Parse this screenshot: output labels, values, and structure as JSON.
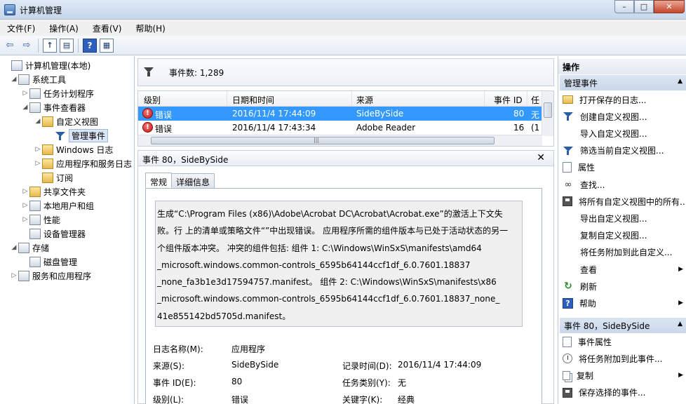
{
  "window": {
    "title": "计算机管理",
    "min": "–",
    "max": "□",
    "close": "✕"
  },
  "menu": [
    "文件(F)",
    "操作(A)",
    "查看(V)",
    "帮助(H)"
  ],
  "toolbar": {
    "back": "⇦",
    "forward": "⇨",
    "help": "?"
  },
  "tree": [
    {
      "label": "计算机管理(本地)",
      "level": 0,
      "arrow": "",
      "icon": "computer-icon"
    },
    {
      "label": "系统工具",
      "level": 1,
      "arrow": "◢",
      "icon": "tools-icon"
    },
    {
      "label": "任务计划程序",
      "level": 2,
      "arrow": "▷",
      "icon": "clock-icon"
    },
    {
      "label": "事件查看器",
      "level": 2,
      "arrow": "◢",
      "icon": "event-viewer-icon"
    },
    {
      "label": "自定义视图",
      "level": 3,
      "arrow": "◢",
      "icon": "folder-icon"
    },
    {
      "label": "管理事件",
      "level": 4,
      "arrow": "",
      "icon": "filter-icon",
      "selected": true
    },
    {
      "label": "Windows 日志",
      "level": 3,
      "arrow": "▷",
      "icon": "folder-icon"
    },
    {
      "label": "应用程序和服务日志",
      "level": 3,
      "arrow": "▷",
      "icon": "folder-icon"
    },
    {
      "label": "订阅",
      "level": 3,
      "arrow": "",
      "icon": "folder-icon"
    },
    {
      "label": "共享文件夹",
      "level": 2,
      "arrow": "▷",
      "icon": "shared-folder-icon"
    },
    {
      "label": "本地用户和组",
      "level": 2,
      "arrow": "▷",
      "icon": "users-icon"
    },
    {
      "label": "性能",
      "level": 2,
      "arrow": "▷",
      "icon": "performance-icon"
    },
    {
      "label": "设备管理器",
      "level": 2,
      "arrow": "",
      "icon": "device-manager-icon"
    },
    {
      "label": "存储",
      "level": 1,
      "arrow": "◢",
      "icon": "storage-icon"
    },
    {
      "label": "磁盘管理",
      "level": 2,
      "arrow": "",
      "icon": "disk-icon"
    },
    {
      "label": "服务和应用程序",
      "level": 1,
      "arrow": "▷",
      "icon": "services-icon"
    }
  ],
  "summary": {
    "count": "事件数: 1,289"
  },
  "grid": {
    "columns": [
      "级别",
      "日期和时间",
      "来源",
      "事件 ID",
      "任"
    ],
    "rows": [
      {
        "level": "错误",
        "datetime": "2016/11/4 17:44:09",
        "source": "SideBySide",
        "id": "80",
        "task": "无",
        "selected": true
      },
      {
        "level": "错误",
        "datetime": "2016/11/4 17:43:34",
        "source": "Adobe Reader",
        "id": "16",
        "task": "(1",
        "selected": false
      }
    ]
  },
  "detail": {
    "title": "事件 80，SideBySide",
    "close": "✕",
    "tabs": [
      "常规",
      "详细信息"
    ],
    "description": "生成“C:\\Program Files (x86)\\Adobe\\Acrobat DC\\Acrobat\\Acrobat.exe”的激活上下文失\n败。行  上的清单或策略文件“”中出现错误。 应用程序所需的组件版本与已处于活动状态的另一\n个组件版本冲突。 冲突的组件包括: 组件 1: C:\\Windows\\WinSxS\\manifests\\amd64\n_microsoft.windows.common-controls_6595b64144ccf1df_6.0.7601.18837\n_none_fa3b1e3d17594757.manifest。 组件 2: C:\\Windows\\WinSxS\\manifests\\x86\n_microsoft.windows.common-controls_6595b64144ccf1df_6.0.7601.18837_none_\n41e855142bd5705d.manifest。",
    "fields": {
      "log_name_label": "日志名称(M):",
      "log_name": "应用程序",
      "source_label": "来源(S):",
      "source": "SideBySide",
      "logged_label": "记录时间(D):",
      "logged": "2016/11/4 17:44:09",
      "event_id_label": "事件 ID(E):",
      "event_id": "80",
      "category_label": "任务类别(Y):",
      "category": "无",
      "level_label": "级别(L):",
      "level": "错误",
      "keywords_label": "关键字(K):",
      "keywords": "经典"
    }
  },
  "actions": {
    "title": "操作",
    "section1": "管理事件",
    "items1": [
      {
        "label": "打开保存的日志...",
        "icon": "folder-icon",
        "sub": false
      },
      {
        "label": "创建自定义视图...",
        "icon": "filter-icon",
        "sub": false
      },
      {
        "label": "导入自定义视图...",
        "icon": "blank",
        "sub": false
      },
      {
        "label": "筛选当前自定义视图...",
        "icon": "filter-icon",
        "sub": false
      },
      {
        "label": "属性",
        "icon": "properties-icon",
        "sub": false
      },
      {
        "label": "查找...",
        "icon": "binoculars-icon",
        "sub": false
      },
      {
        "label": "将所有自定义视图中的所有...",
        "icon": "save-icon",
        "sub": false
      },
      {
        "label": "导出自定义视图...",
        "icon": "blank",
        "sub": false
      },
      {
        "label": "复制自定义视图...",
        "icon": "blank",
        "sub": false
      },
      {
        "label": "将任务附加到此自定义...",
        "icon": "blank",
        "sub": false
      },
      {
        "label": "查看",
        "icon": "blank",
        "sub": true
      },
      {
        "label": "刷新",
        "icon": "refresh-icon",
        "sub": false
      },
      {
        "label": "帮助",
        "icon": "help-icon",
        "sub": true
      }
    ],
    "section2": "事件 80，SideBySide",
    "items2": [
      {
        "label": "事件属性",
        "icon": "properties-icon",
        "sub": false
      },
      {
        "label": "将任务附加到此事件...",
        "icon": "clock-icon",
        "sub": false
      },
      {
        "label": "复制",
        "icon": "copy-icon",
        "sub": true
      },
      {
        "label": "保存选择的事件...",
        "icon": "save-icon",
        "sub": false
      }
    ]
  }
}
